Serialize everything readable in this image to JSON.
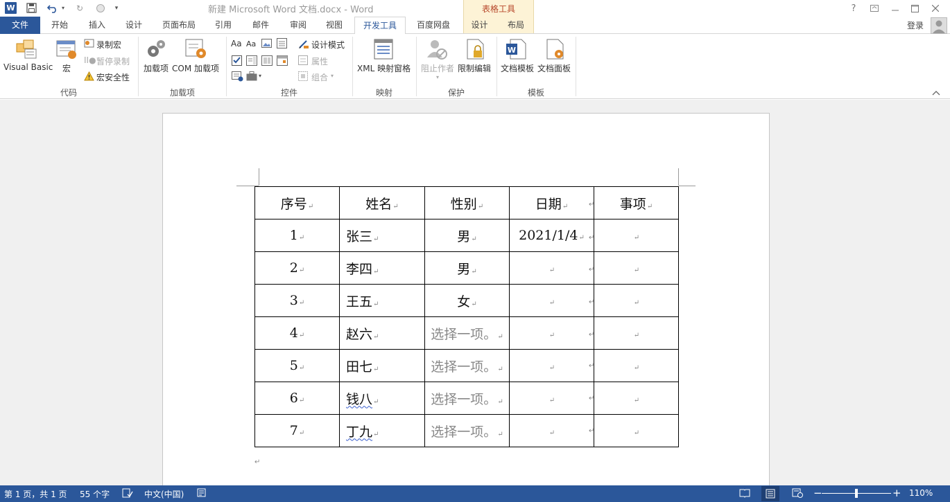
{
  "titlebar": {
    "doc_title": "新建 Microsoft Word 文档.docx - Word",
    "context_group": "表格工具",
    "help": "?"
  },
  "tabs": [
    {
      "label": "文件"
    },
    {
      "label": "开始"
    },
    {
      "label": "插入"
    },
    {
      "label": "设计"
    },
    {
      "label": "页面布局"
    },
    {
      "label": "引用"
    },
    {
      "label": "邮件"
    },
    {
      "label": "审阅"
    },
    {
      "label": "视图"
    },
    {
      "label": "开发工具"
    },
    {
      "label": "百度网盘"
    },
    {
      "label": "设计"
    },
    {
      "label": "布局"
    }
  ],
  "account": {
    "login": "登录"
  },
  "ribbon": {
    "code": {
      "label": "代码",
      "visual_basic": "Visual Basic",
      "macros": "宏",
      "record_macro": "录制宏",
      "pause_recording": "暂停录制",
      "macro_security": "宏安全性"
    },
    "addins": {
      "label": "加载项",
      "addins": "加载项",
      "com_addins": "COM 加载项"
    },
    "controls": {
      "label": "控件",
      "design_mode": "设计模式",
      "properties": "属性",
      "group": "组合"
    },
    "mapping": {
      "label": "映射",
      "xml_pane": "XML 映射窗格"
    },
    "protect": {
      "label": "保护",
      "block_authors": "阻止作者",
      "restrict_editing": "限制编辑"
    },
    "templates": {
      "label": "模板",
      "doc_template": "文档模板",
      "doc_panel": "文档面板"
    },
    "aa1": "Aa",
    "aa2": "Aa"
  },
  "table": {
    "headers": [
      "序号",
      "姓名",
      "性别",
      "日期",
      "事项"
    ],
    "rows": [
      {
        "no": "1",
        "name": "张三",
        "gender": "男",
        "date": "2021/1/4",
        "item": ""
      },
      {
        "no": "2",
        "name": "李四",
        "gender": "男",
        "date": "",
        "item": ""
      },
      {
        "no": "3",
        "name": "王五",
        "gender": "女",
        "date": "",
        "item": ""
      },
      {
        "no": "4",
        "name": "赵六",
        "gender": "选择一项。",
        "date": "",
        "item": ""
      },
      {
        "no": "5",
        "name": "田七",
        "gender": "选择一项。",
        "date": "",
        "item": ""
      },
      {
        "no": "6",
        "name": "钱八",
        "gender": "选择一项。",
        "date": "",
        "item": ""
      },
      {
        "no": "7",
        "name": "丁九",
        "gender": "选择一项。",
        "date": "",
        "item": ""
      }
    ]
  },
  "status": {
    "page": "第 1 页，共 1 页",
    "words": "55 个字",
    "language": "中文(中国)",
    "zoom": "110%",
    "zoom_minus": "−",
    "zoom_plus": "+"
  },
  "colors": {
    "accent": "#2b579a",
    "context": "#b7472a"
  }
}
